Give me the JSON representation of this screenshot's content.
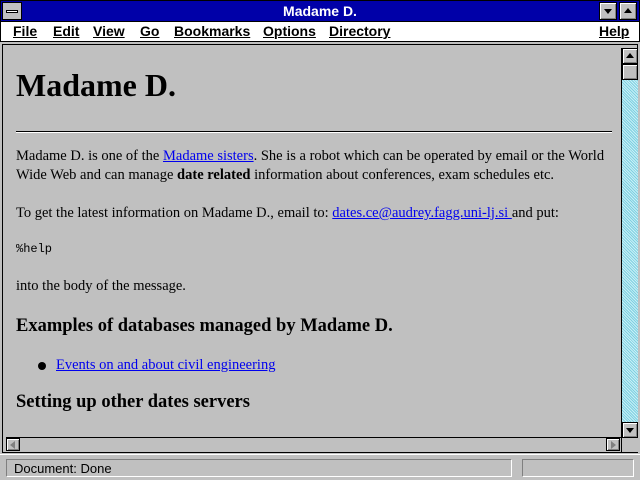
{
  "window": {
    "title": "Madame D."
  },
  "menu": {
    "items": [
      "File",
      "Edit",
      "View",
      "Go",
      "Bookmarks",
      "Options",
      "Directory"
    ],
    "help": "Help"
  },
  "page": {
    "heading": "Madame D.",
    "intro": {
      "t1": "Madame D. is one of the ",
      "link": "Madame sisters",
      "t2": ". She is a robot which can be operated by email or the World Wide Web and can manage ",
      "bold": "date related",
      "t3": " information about conferences, exam schedules etc."
    },
    "email_para": {
      "t1": "To get the latest information on Madame D., email to: ",
      "link": "dates.ce@audrey.fagg.uni-lj.si ",
      "t2": "and put:"
    },
    "command": "%help",
    "after_command": "into the body of the message.",
    "section1_heading": "Examples of databases managed by Madame D.",
    "section1_items": [
      "Events on and about civil engineering "
    ],
    "section2_heading": "Setting up other dates servers"
  },
  "status": {
    "text": "Document: Done"
  }
}
